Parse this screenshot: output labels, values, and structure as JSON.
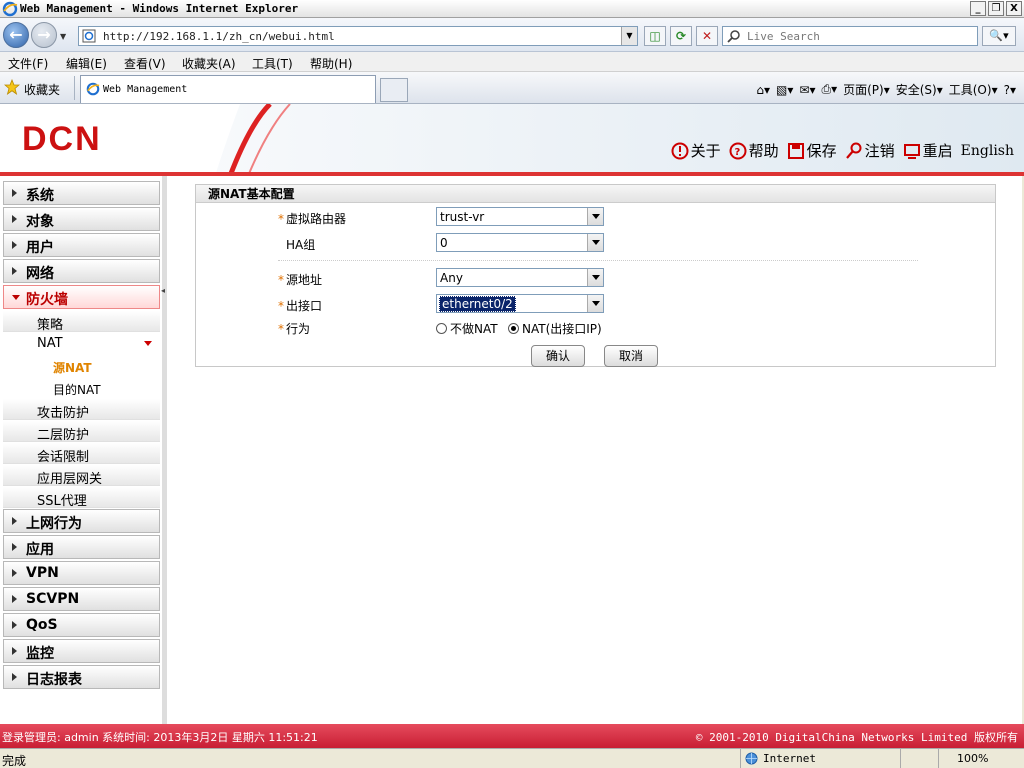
{
  "window": {
    "title": "Web Management - Windows Internet Explorer",
    "minimize": "_",
    "maximize": "❐",
    "close": "X"
  },
  "addressbar": {
    "url": "http://192.168.1.1/zh_cn/webui.html",
    "search_placeholder": "Live Search"
  },
  "menubar": {
    "items": [
      "文件(F)",
      "编辑(E)",
      "查看(V)",
      "收藏夹(A)",
      "工具(T)",
      "帮助(H)"
    ]
  },
  "favbar": {
    "favorites": "收藏夹",
    "tab_title": "Web Management",
    "page": "页面(P)",
    "safety": "安全(S)",
    "tools": "工具(O)"
  },
  "header": {
    "logo": "DCN",
    "nav": {
      "about": "关于",
      "help": "帮助",
      "save": "保存",
      "logout": "注销",
      "restart": "重启",
      "english": "English"
    }
  },
  "sidebar": {
    "system": "系统",
    "object": "对象",
    "user": "用户",
    "network": "网络",
    "firewall": "防火墙",
    "policy": "策略",
    "nat": "NAT",
    "snat": "源NAT",
    "dnat": "目的NAT",
    "attack": "攻击防护",
    "l2": "二层防护",
    "session": "会话限制",
    "alg": "应用层网关",
    "ssl": "SSL代理",
    "behavior": "上网行为",
    "app": "应用",
    "vpn": "VPN",
    "scvpn": "SCVPN",
    "qos": "QoS",
    "monitor": "监控",
    "log": "日志报表"
  },
  "form": {
    "title": "源NAT基本配置",
    "req": "*",
    "vrouter_label": "虚拟路由器",
    "vrouter_value": "trust-vr",
    "ha_label": "HA组",
    "ha_value": "0",
    "src_label": "源地址",
    "src_value": "Any",
    "egress_label": "出接口",
    "egress_value": "ethernet0/2",
    "action_label": "行为",
    "action_opt1": "不做NAT",
    "action_opt2": "NAT(出接口IP)",
    "selected_action": "NAT(出接口IP)",
    "ok": "确认",
    "cancel": "取消"
  },
  "footer": {
    "left": "登录管理员: admin 系统时间: 2013年3月2日 星期六 11:51:21",
    "right": "© 2001-2010 DigitalChina Networks Limited 版权所有"
  },
  "statusbar": {
    "done": "完成",
    "zone": "Internet",
    "zoom": "100%"
  },
  "colors": {
    "brand_red": "#cc1111",
    "footer_red": "#d62f44",
    "active_orange": "#e08400"
  }
}
